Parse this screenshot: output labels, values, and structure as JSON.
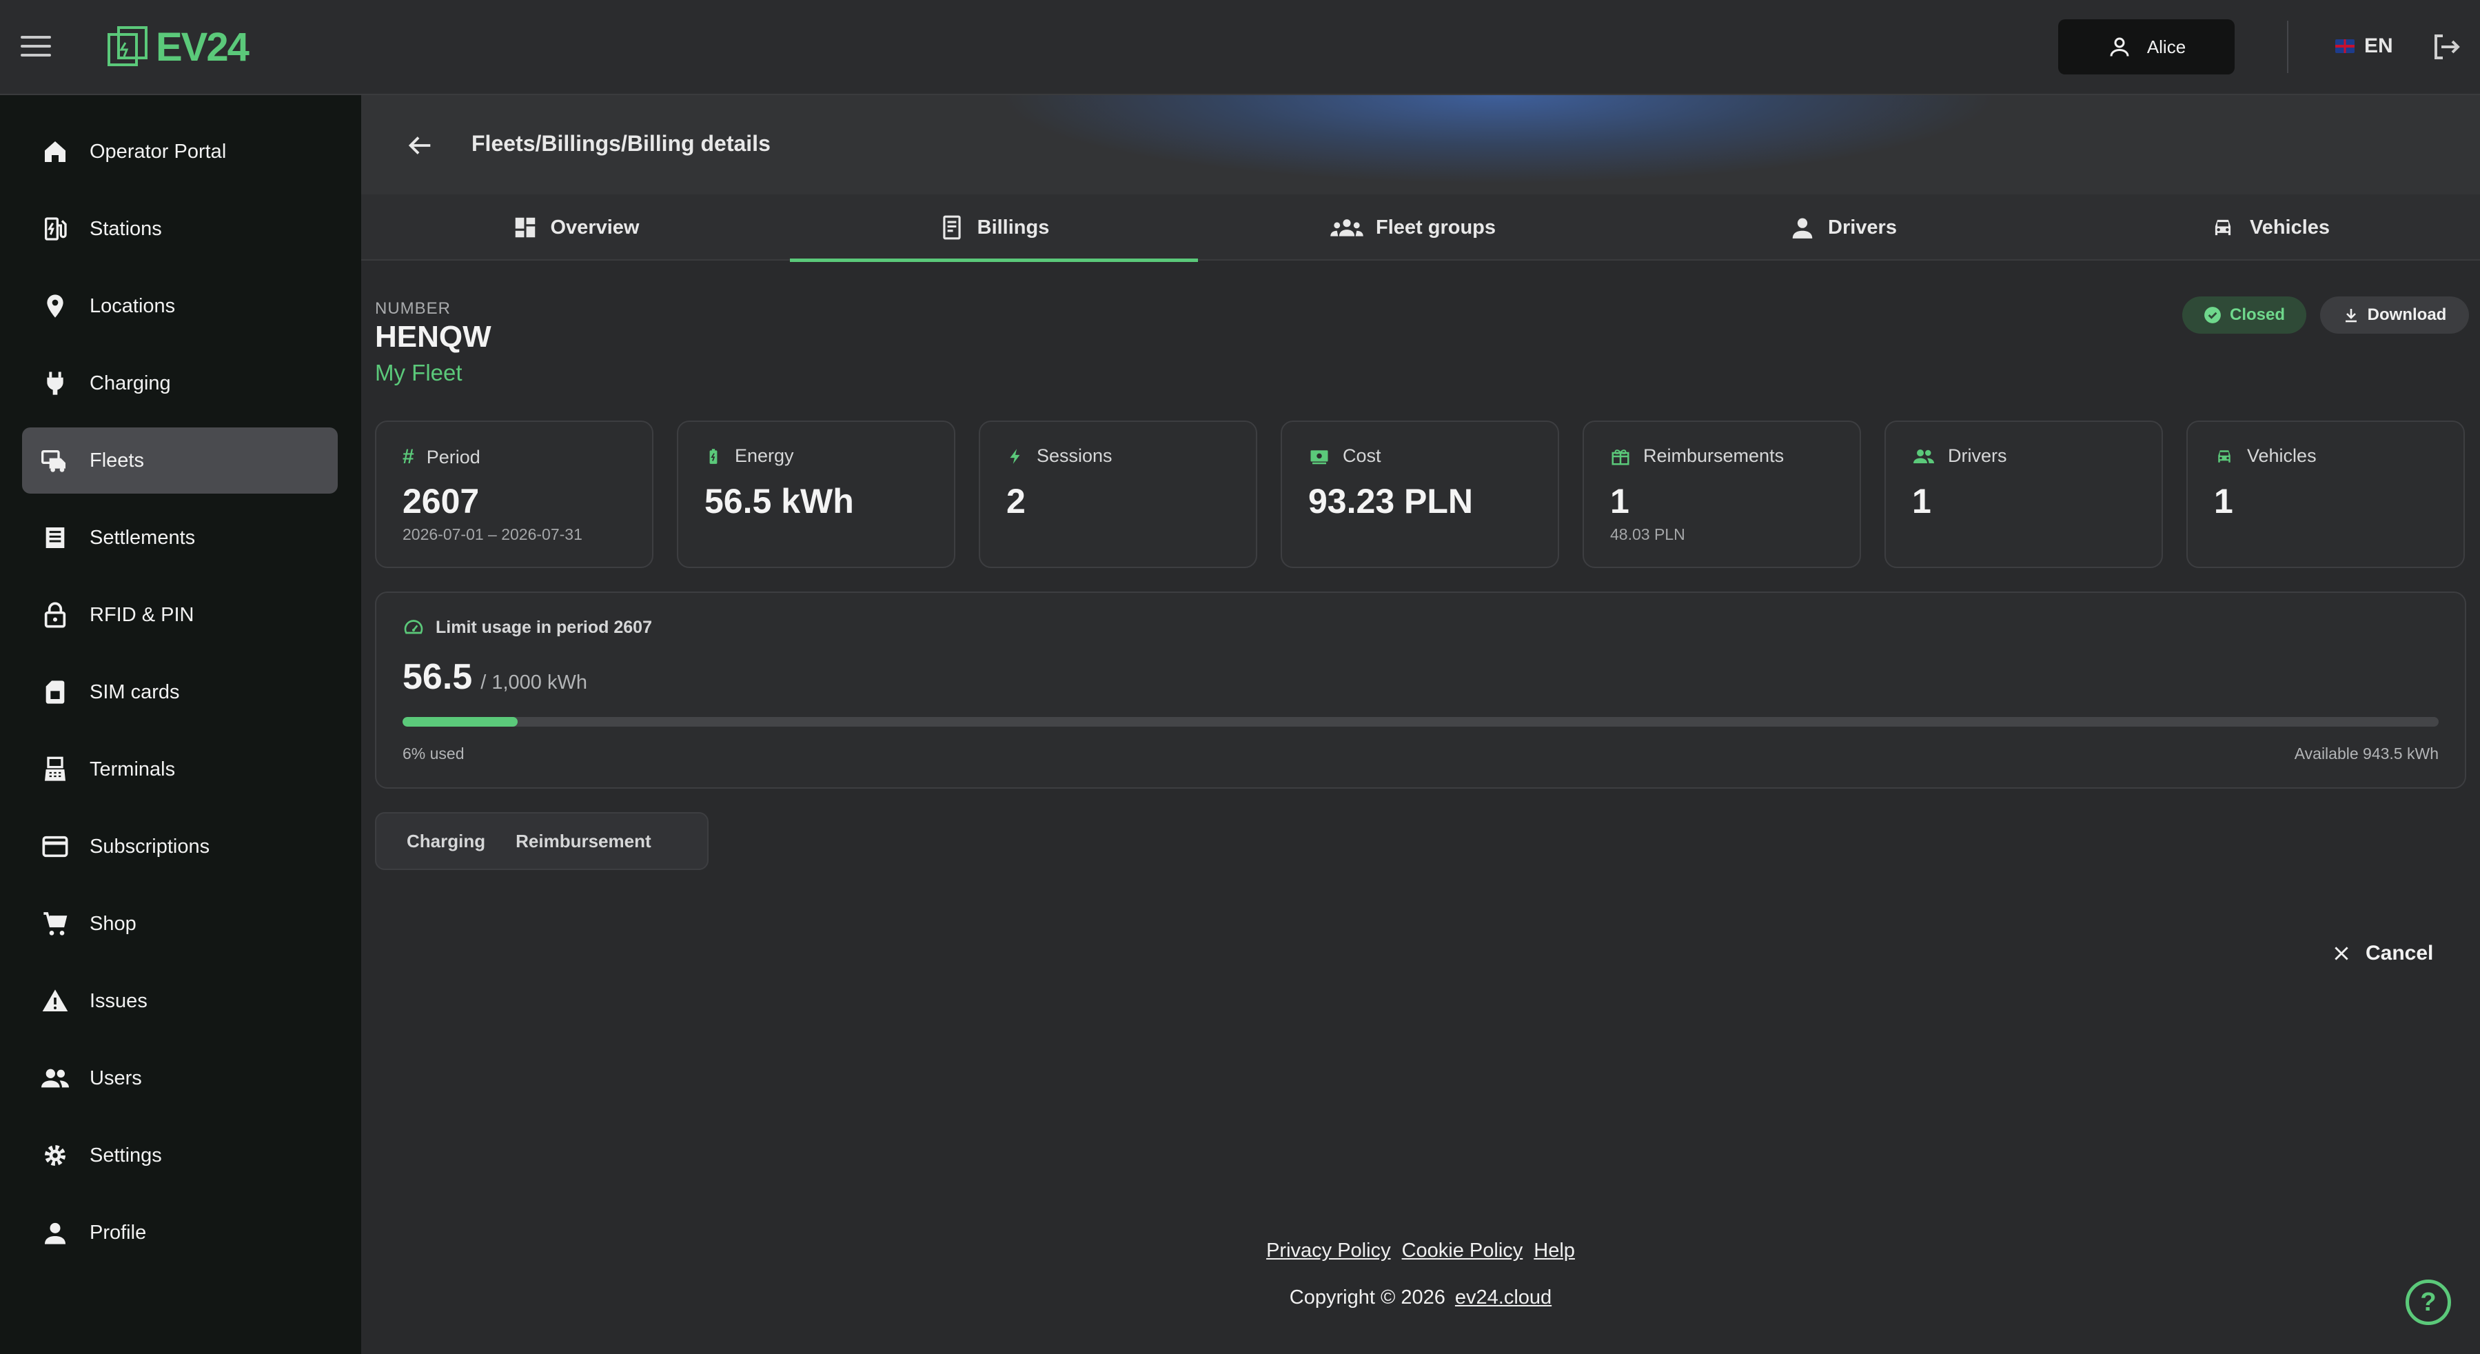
{
  "app": {
    "logo_text": "EV24"
  },
  "topbar": {
    "user_name": "Alice",
    "language": "EN"
  },
  "sidebar": {
    "items": [
      {
        "label": "Operator Portal",
        "icon": "home-icon"
      },
      {
        "label": "Stations",
        "icon": "ev-station-icon"
      },
      {
        "label": "Locations",
        "icon": "location-pin-icon"
      },
      {
        "label": "Charging",
        "icon": "plug-icon"
      },
      {
        "label": "Fleets",
        "icon": "fleet-icon",
        "active": true
      },
      {
        "label": "Settlements",
        "icon": "receipt-icon"
      },
      {
        "label": "RFID & PIN",
        "icon": "lock-icon"
      },
      {
        "label": "SIM cards",
        "icon": "sim-card-icon"
      },
      {
        "label": "Terminals",
        "icon": "terminal-icon"
      },
      {
        "label": "Subscriptions",
        "icon": "credit-card-icon"
      },
      {
        "label": "Shop",
        "icon": "cart-icon"
      },
      {
        "label": "Issues",
        "icon": "warning-icon"
      },
      {
        "label": "Users",
        "icon": "users-icon"
      },
      {
        "label": "Settings",
        "icon": "gear-icon"
      },
      {
        "label": "Profile",
        "icon": "person-icon"
      }
    ]
  },
  "header": {
    "breadcrumb": "Fleets/Billings/Billing details"
  },
  "tabs": [
    {
      "label": "Overview",
      "icon": "dashboard-icon"
    },
    {
      "label": "Billings",
      "icon": "billing-icon",
      "active": true
    },
    {
      "label": "Fleet groups",
      "icon": "groups-icon"
    },
    {
      "label": "Drivers",
      "icon": "person-icon"
    },
    {
      "label": "Vehicles",
      "icon": "car-icon"
    }
  ],
  "billing": {
    "number_label": "NUMBER",
    "number": "HENQW",
    "fleet_name": "My Fleet",
    "status": "Closed",
    "download_label": "Download"
  },
  "stats": [
    {
      "label": "Period",
      "value": "2607",
      "sub": "2026-07-01 – 2026-07-31",
      "icon": "hash-icon"
    },
    {
      "label": "Energy",
      "value": "56.5 kWh",
      "sub": "",
      "icon": "battery-icon"
    },
    {
      "label": "Sessions",
      "value": "2",
      "sub": "",
      "icon": "bolt-icon"
    },
    {
      "label": "Cost",
      "value": "93.23 PLN",
      "sub": "",
      "icon": "money-icon"
    },
    {
      "label": "Reimbursements",
      "value": "1",
      "sub": "48.03 PLN",
      "icon": "gift-icon"
    },
    {
      "label": "Drivers",
      "value": "1",
      "sub": "",
      "icon": "users-icon"
    },
    {
      "label": "Vehicles",
      "value": "1",
      "sub": "",
      "icon": "car-icon"
    }
  ],
  "limit": {
    "title": "Limit usage in period 2607",
    "used_value": "56.5",
    "total": "/ 1,000 kWh",
    "used_fraction": 0.0565,
    "used_text": "6% used",
    "available_text": "Available 943.5 kWh"
  },
  "segments": {
    "charging": "Charging",
    "reimbursement": "Reimbursement"
  },
  "actions": {
    "cancel": "Cancel"
  },
  "footer": {
    "privacy": "Privacy Policy",
    "cookie": "Cookie Policy",
    "help": "Help",
    "copyright": "Copyright © 2026",
    "site": "ev24.cloud"
  },
  "colors": {
    "accent": "#5bc97a",
    "sidebar_bg": "#121614",
    "main_bg": "#292a2c"
  }
}
